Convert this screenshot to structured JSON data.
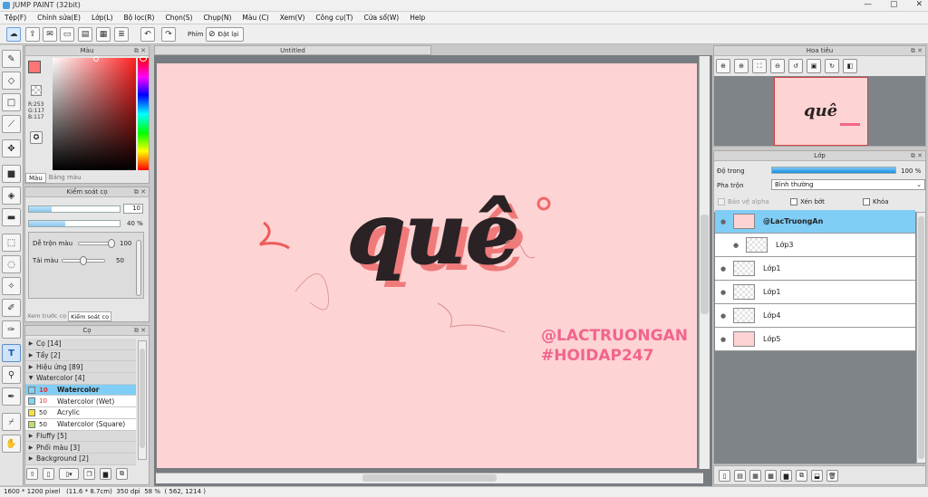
{
  "title": "JUMP PAINT (32bit)",
  "window_buttons": [
    "—",
    "▢",
    "✕"
  ],
  "menu": [
    "Tệp(F)",
    "Chỉnh sửa(E)",
    "Lớp(L)",
    "Bộ lọc(R)",
    "Chọn(S)",
    "Chụp(N)",
    "Màu (C)",
    "Xem(V)",
    "Công cụ(T)",
    "Cửa sổ(W)",
    "Help"
  ],
  "toolbar": {
    "phim_label": "Phím",
    "reset_label": "Đặt lại"
  },
  "color_panel": {
    "title": "Màu",
    "r": "R:253",
    "g": "G:117",
    "b": "B:117",
    "tab_color": "Màu",
    "tab_board": "Bảng màu",
    "main_color": "#fd7575"
  },
  "brush_control": {
    "title": "Kiểm soát cọ",
    "size_value": "10",
    "size_fraction": 0.25,
    "opacity_value": "40 %",
    "opacity_fraction": 0.4,
    "mix_label": "Dễ trộn màu",
    "mix_value": "100",
    "mix_fraction": 1.0,
    "paint_label": "Tải màu",
    "paint_value": "50",
    "paint_fraction": 0.5,
    "tab_preview": "Xem trước cọ",
    "tab_control": "Kiểm soát cọ"
  },
  "brush_panel": {
    "title": "Cọ",
    "groups": [
      {
        "arrow": "▶",
        "label": "Cọ [14]"
      },
      {
        "arrow": "▶",
        "label": "Tẩy [2]"
      },
      {
        "arrow": "▶",
        "label": "Hiệu ứng [89]"
      },
      {
        "arrow": "▼",
        "label": "Watercolor [4]"
      }
    ],
    "items": [
      {
        "num": "10",
        "label": "Watercolor",
        "color": "#80d4f5"
      },
      {
        "num": "10",
        "label": "Watercolor (Wet)",
        "color": "#80d4f5"
      },
      {
        "num": "50",
        "label": "Acrylic",
        "color": "#f3e23a"
      },
      {
        "num": "50",
        "label": "Watercolor (Square)",
        "color": "#b8e06a"
      }
    ],
    "groups_after": [
      {
        "arrow": "▶",
        "label": "Fluffy [5]"
      },
      {
        "arrow": "▶",
        "label": "Phối màu [3]"
      },
      {
        "arrow": "▶",
        "label": "Background [2]"
      }
    ]
  },
  "document": {
    "tab": "Untitled",
    "art_word": "quê",
    "watermark1": "@LACTRUONGAN",
    "watermark2": "#HOIDAP247"
  },
  "navigator": {
    "title": "Hoa tiêu"
  },
  "layers_panel": {
    "title": "Lớp",
    "opacity_label": "Độ trong",
    "opacity_value": "100 %",
    "opacity_fraction": 1.0,
    "blend_label": "Pha trộn",
    "blend_value": "Bình thường",
    "protect_alpha": "Bảo vệ alpha",
    "clip": "Xén bớt",
    "lock": "Khóa",
    "layers": [
      {
        "name": "@LacTruongAn"
      },
      {
        "name": "Lớp3"
      },
      {
        "name": "Lớp1"
      },
      {
        "name": "Lớp1"
      },
      {
        "name": "Lớp4"
      },
      {
        "name": "Lớp5"
      }
    ]
  },
  "status": {
    "size": "1600 * 1200 pixel",
    "cm": "(11.6 * 8.7cm)",
    "dpi": "350 dpi",
    "zoom": "58 %",
    "coords": "( 562, 1214 )"
  }
}
